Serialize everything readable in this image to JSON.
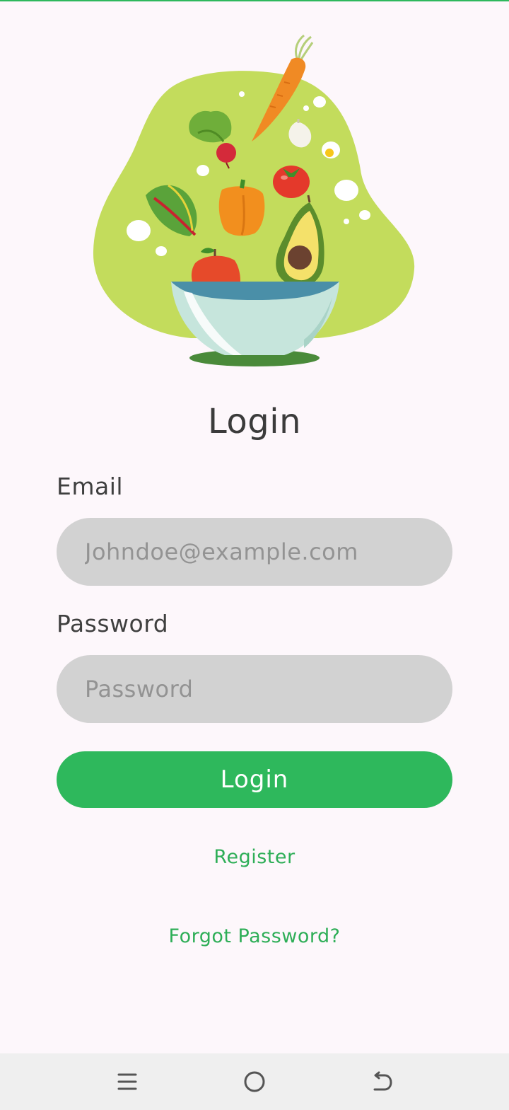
{
  "colors": {
    "accent": "#2eb85c",
    "background": "#fdf7fb",
    "input_background": "#d2d2d2",
    "blob": "#c3dc5c",
    "nav_background": "#efefef"
  },
  "login": {
    "title": "Login",
    "email_label": "Email",
    "email_placeholder": "Johndoe@example.com",
    "email_value": "",
    "password_label": "Password",
    "password_placeholder": "Password",
    "password_value": "",
    "submit_label": "Login",
    "register_label": "Register",
    "forgot_label": "Forgot Password?"
  },
  "hero": {
    "icon": "vegetable-salad-bowl-illustration"
  },
  "nav_bar": {
    "icons": [
      "menu-icon",
      "home-icon",
      "back-icon"
    ]
  }
}
